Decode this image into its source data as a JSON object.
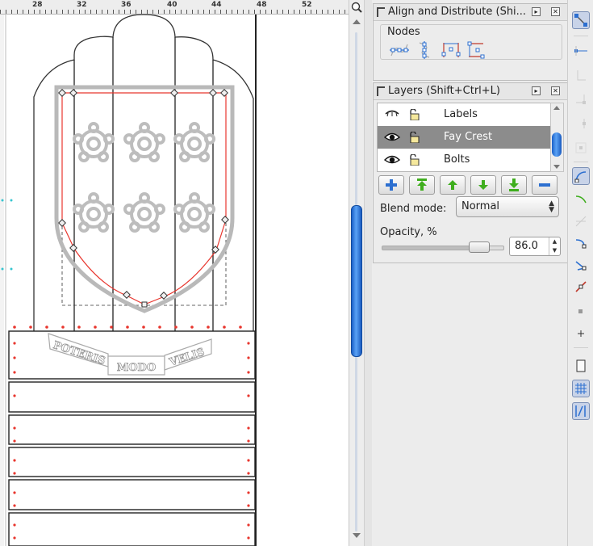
{
  "ruler": {
    "labels": [
      "28",
      "32",
      "36",
      "40",
      "44",
      "48",
      "52"
    ]
  },
  "canvas": {
    "motto_words": [
      "POTERIS",
      "MODO",
      "VELIS"
    ]
  },
  "align_panel": {
    "title": "Align and Distribute (Shi...",
    "section_label": "Nodes",
    "icons": [
      "align-nodes-horizontal-icon",
      "align-nodes-vertical-icon",
      "distribute-nodes-horizontal-icon",
      "distribute-nodes-vertical-icon"
    ]
  },
  "layers_panel": {
    "title": "Layers (Shift+Ctrl+L)",
    "layers": [
      {
        "name": "Labels",
        "visible": false,
        "locked": false,
        "selected": false
      },
      {
        "name": "Fay Crest",
        "visible": true,
        "locked": false,
        "selected": true
      },
      {
        "name": "Bolts",
        "visible": true,
        "locked": false,
        "selected": false
      }
    ],
    "buttons": [
      "add-layer",
      "raise-layer-to-top",
      "raise-layer",
      "lower-layer",
      "lower-layer-to-bottom",
      "delete-layer"
    ],
    "blend_mode_label": "Blend mode:",
    "blend_mode_value": "Normal",
    "opacity_label": "Opacity, %",
    "opacity_value": "86.0",
    "opacity_fraction": 0.86
  },
  "snap_toolbar": {
    "tools": [
      "snap-toggle",
      "snap-bbox",
      "snap-bbox-edge",
      "snap-bbox-corner",
      "snap-bbox-midpoint",
      "snap-bbox-center",
      "snap-nodes",
      "snap-path",
      "snap-path-intersection",
      "snap-cusp-nodes",
      "snap-smooth-nodes",
      "snap-line-midpoint",
      "snap-object-center",
      "snap-rotation-center",
      "snap-page-border",
      "snap-grid",
      "snap-guide"
    ],
    "active_tools": [
      "snap-toggle",
      "snap-nodes",
      "snap-grid",
      "snap-guide"
    ]
  },
  "colors": {
    "accent": "#1a60c8",
    "path_red": "#e8362e",
    "shield_gray": "#b9b9b9",
    "selected_row": "#8c8c8c",
    "button_green": "#3fae1e",
    "button_blue": "#2c6fd0"
  }
}
